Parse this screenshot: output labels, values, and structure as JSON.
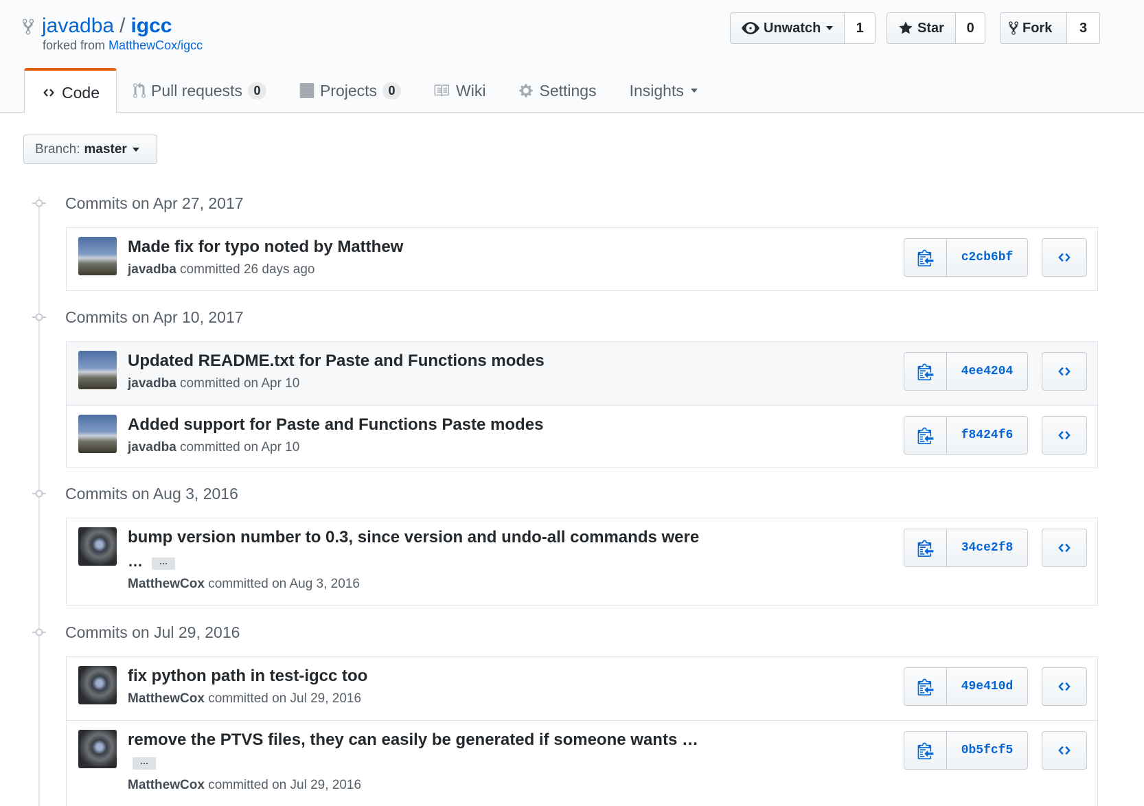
{
  "repo": {
    "owner": "javadba",
    "separator": "/",
    "name": "igcc",
    "forked_prefix": "forked from",
    "forked_from": "MatthewCox/igcc"
  },
  "actions": {
    "watch": {
      "label": "Unwatch",
      "count": "1"
    },
    "star": {
      "label": "Star",
      "count": "0"
    },
    "fork": {
      "label": "Fork",
      "count": "3"
    }
  },
  "tabs": [
    {
      "label": "Code",
      "icon": "code-icon",
      "selected": true
    },
    {
      "label": "Pull requests",
      "count": "0",
      "icon": "git-pull-request-icon"
    },
    {
      "label": "Projects",
      "count": "0",
      "icon": "project-icon"
    },
    {
      "label": "Wiki",
      "icon": "book-icon"
    },
    {
      "label": "Settings",
      "icon": "gear-icon"
    },
    {
      "label": "Insights",
      "icon": "chevron-down-icon"
    }
  ],
  "branch": {
    "label": "Branch:",
    "value": "master"
  },
  "groups": [
    {
      "title": "Commits on Apr 27, 2017",
      "commits": [
        {
          "message": "Made fix for typo noted by Matthew",
          "author": "javadba",
          "when": "committed 26 days ago",
          "sha": "c2cb6bf"
        }
      ]
    },
    {
      "title": "Commits on Apr 10, 2017",
      "commits": [
        {
          "message": "Updated README.txt for Paste and Functions modes",
          "author": "javadba",
          "when": "committed on Apr 10",
          "sha": "4ee4204"
        },
        {
          "message": "Added support for Paste and Functions Paste modes",
          "author": "javadba",
          "when": "committed on Apr 10",
          "sha": "f8424f6"
        }
      ]
    },
    {
      "title": "Commits on Aug 3, 2016",
      "commits": [
        {
          "message": "bump version number to 0.3, since version and undo-all commands were",
          "ellipsis": "…",
          "author": "MatthewCox",
          "when": "committed on Aug 3, 2016",
          "sha": "34ce2f8"
        }
      ]
    },
    {
      "title": "Commits on Jul 29, 2016",
      "commits": [
        {
          "message": "fix python path in test-igcc too",
          "author": "MatthewCox",
          "when": "committed on Jul 29, 2016",
          "sha": "49e410d"
        },
        {
          "message": "remove the PTVS files, they can easily be generated if someone wants …",
          "author": "MatthewCox",
          "when": "committed on Jul 29, 2016",
          "sha": "0b5fcf5"
        }
      ]
    }
  ],
  "hidden_text_button": "…",
  "colors": {
    "link": "#0366d6",
    "tab_accent": "#e36209",
    "text": "#24292e",
    "muted": "#586069"
  }
}
